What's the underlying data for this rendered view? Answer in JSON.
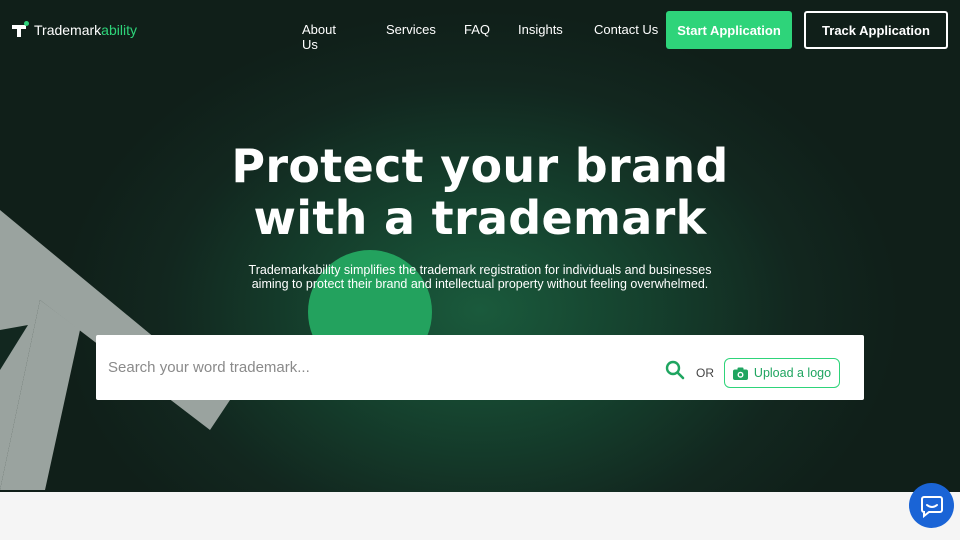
{
  "brand": {
    "name_part1": "Trademark",
    "name_part2": "ability"
  },
  "nav": {
    "items": [
      "About Us",
      "Services",
      "FAQ",
      "Insights",
      "Contact Us"
    ],
    "start_application": "Start Application",
    "track_application": "Track Application"
  },
  "hero": {
    "headline_line1": "Protect your brand",
    "headline_line2": "with a trademark",
    "subtext_line1": "Trademarkability simplifies the trademark registration for individuals and businesses",
    "subtext_line2": "aiming to protect their brand and intellectual property without feeling overwhelmed."
  },
  "search": {
    "placeholder": "Search your word trademark...",
    "value": "",
    "or_label": "OR",
    "upload_label": "Upload a logo"
  },
  "icons": {
    "search": "search-icon",
    "camera": "camera-icon",
    "chat": "chat-icon"
  },
  "colors": {
    "accent": "#2ed47a",
    "hero_bg": "#12271f",
    "chat": "#1a64d6"
  }
}
